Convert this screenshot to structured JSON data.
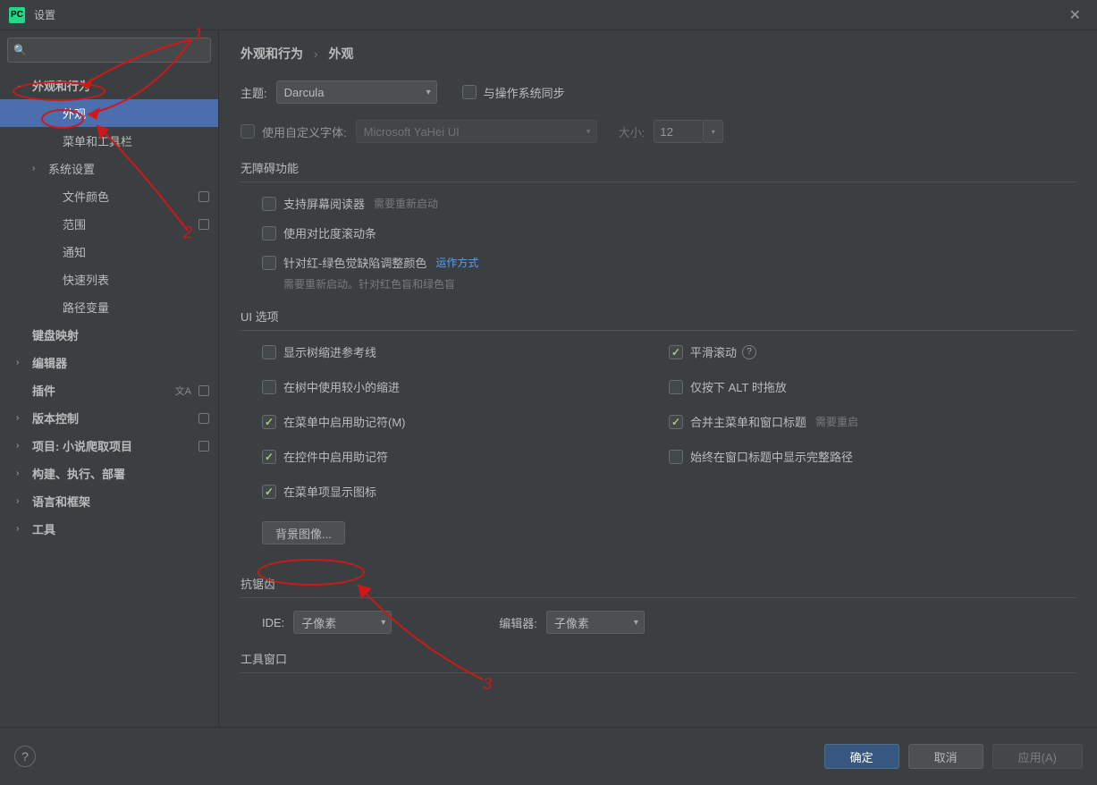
{
  "title": "设置",
  "sidebar": {
    "items": [
      {
        "label": "外观和行为",
        "chevron": "down",
        "indent": 0,
        "bold": true
      },
      {
        "label": "外观",
        "chevron": "",
        "indent": 2,
        "selected": true
      },
      {
        "label": "菜单和工具栏",
        "chevron": "",
        "indent": 2
      },
      {
        "label": "系统设置",
        "chevron": "right",
        "indent": 1
      },
      {
        "label": "文件颜色",
        "chevron": "",
        "indent": 2,
        "badge": true
      },
      {
        "label": "范围",
        "chevron": "",
        "indent": 2,
        "badge": true
      },
      {
        "label": "通知",
        "chevron": "",
        "indent": 2
      },
      {
        "label": "快速列表",
        "chevron": "",
        "indent": 2
      },
      {
        "label": "路径变量",
        "chevron": "",
        "indent": 2
      },
      {
        "label": "键盘映射",
        "chevron": "",
        "indent": 0,
        "bold": true
      },
      {
        "label": "编辑器",
        "chevron": "right",
        "indent": 0,
        "bold": true
      },
      {
        "label": "插件",
        "chevron": "",
        "indent": 0,
        "bold": true,
        "lang": true,
        "badge": true
      },
      {
        "label": "版本控制",
        "chevron": "right",
        "indent": 0,
        "bold": true,
        "badge": true
      },
      {
        "label": "项目: 小说爬取项目",
        "chevron": "right",
        "indent": 0,
        "bold": true,
        "badge": true
      },
      {
        "label": "构建、执行、部署",
        "chevron": "right",
        "indent": 0,
        "bold": true
      },
      {
        "label": "语言和框架",
        "chevron": "right",
        "indent": 0,
        "bold": true
      },
      {
        "label": "工具",
        "chevron": "right",
        "indent": 0,
        "bold": true
      }
    ]
  },
  "breadcrumb": {
    "root": "外观和行为",
    "leaf": "外观",
    "sep": "›"
  },
  "theme": {
    "label": "主题:",
    "value": "Darcula",
    "sync": "与操作系统同步"
  },
  "font": {
    "use_custom": "使用自定义字体:",
    "value": "Microsoft YaHei UI",
    "size_label": "大小:",
    "size_value": "12"
  },
  "a11y": {
    "title": "无障碍功能",
    "screen_reader": "支持屏幕阅读器",
    "screen_reader_hint": "需要重新启动",
    "contrast": "使用对比度滚动条",
    "deuter": "针对红-绿色觉缺陷调整颜色",
    "deuter_link": "运作方式",
    "deuter_hint": "需要重新启动。针对红色盲和绿色盲"
  },
  "ui": {
    "title": "UI 选项",
    "tree_guides": "显示树缩进参考线",
    "small_indent": "在树中使用较小的缩进",
    "mnemonic_menu": "在菜单中启用助记符(M)",
    "mnemonic_ctrl": "在控件中启用助记符",
    "menu_icons": "在菜单项显示图标",
    "smooth_scroll": "平滑滚动",
    "alt_drag": "仅按下 ALT 时拖放",
    "merge_title": "合并主菜单和窗口标题",
    "merge_hint": "需要重启",
    "full_path": "始终在窗口标题中显示完整路径",
    "bg_image": "背景图像..."
  },
  "aa": {
    "title": "抗锯齿",
    "ide_label": "IDE:",
    "ide_value": "子像素",
    "editor_label": "编辑器:",
    "editor_value": "子像素"
  },
  "toolwin": {
    "title": "工具窗口"
  },
  "footer": {
    "ok": "确定",
    "cancel": "取消",
    "apply": "应用(A)"
  },
  "anno": {
    "n1": "1",
    "n2": "2",
    "n3": "3"
  }
}
